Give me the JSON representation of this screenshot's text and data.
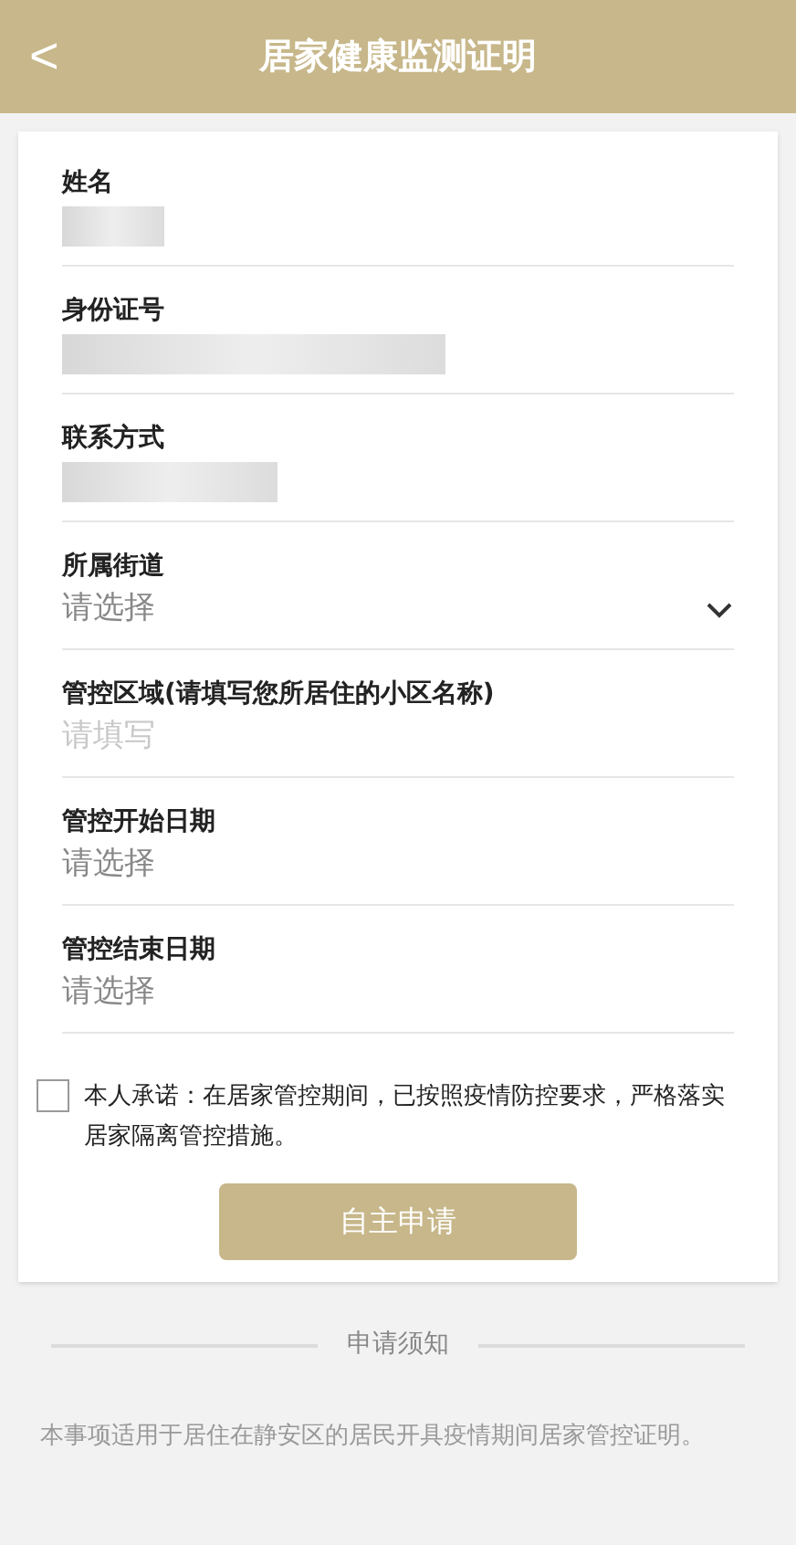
{
  "header": {
    "back": "<",
    "title": "居家健康监测证明"
  },
  "fields": [
    {
      "label": "姓名",
      "kind": "redacted"
    },
    {
      "label": "身份证号",
      "kind": "redacted"
    },
    {
      "label": "联系方式",
      "kind": "redacted"
    },
    {
      "label": "所属街道",
      "kind": "select",
      "placeholder": "请选择"
    },
    {
      "label": "管控区域(请填写您所居住的小区名称)",
      "kind": "input",
      "placeholder": "请填写"
    },
    {
      "label": "管控开始日期",
      "kind": "date",
      "placeholder": "请选择"
    },
    {
      "label": "管控结束日期",
      "kind": "date",
      "placeholder": "请选择"
    }
  ],
  "pledge": {
    "checked": false,
    "text": "本人承诺：在居家管控期间，已按照疫情防控要求，严格落实居家隔离管控措施。"
  },
  "submit": "自主申请",
  "notice": {
    "title": "申请须知",
    "text": "本事项适用于居住在静安区的居民开具疫情期间居家管控证明。"
  }
}
